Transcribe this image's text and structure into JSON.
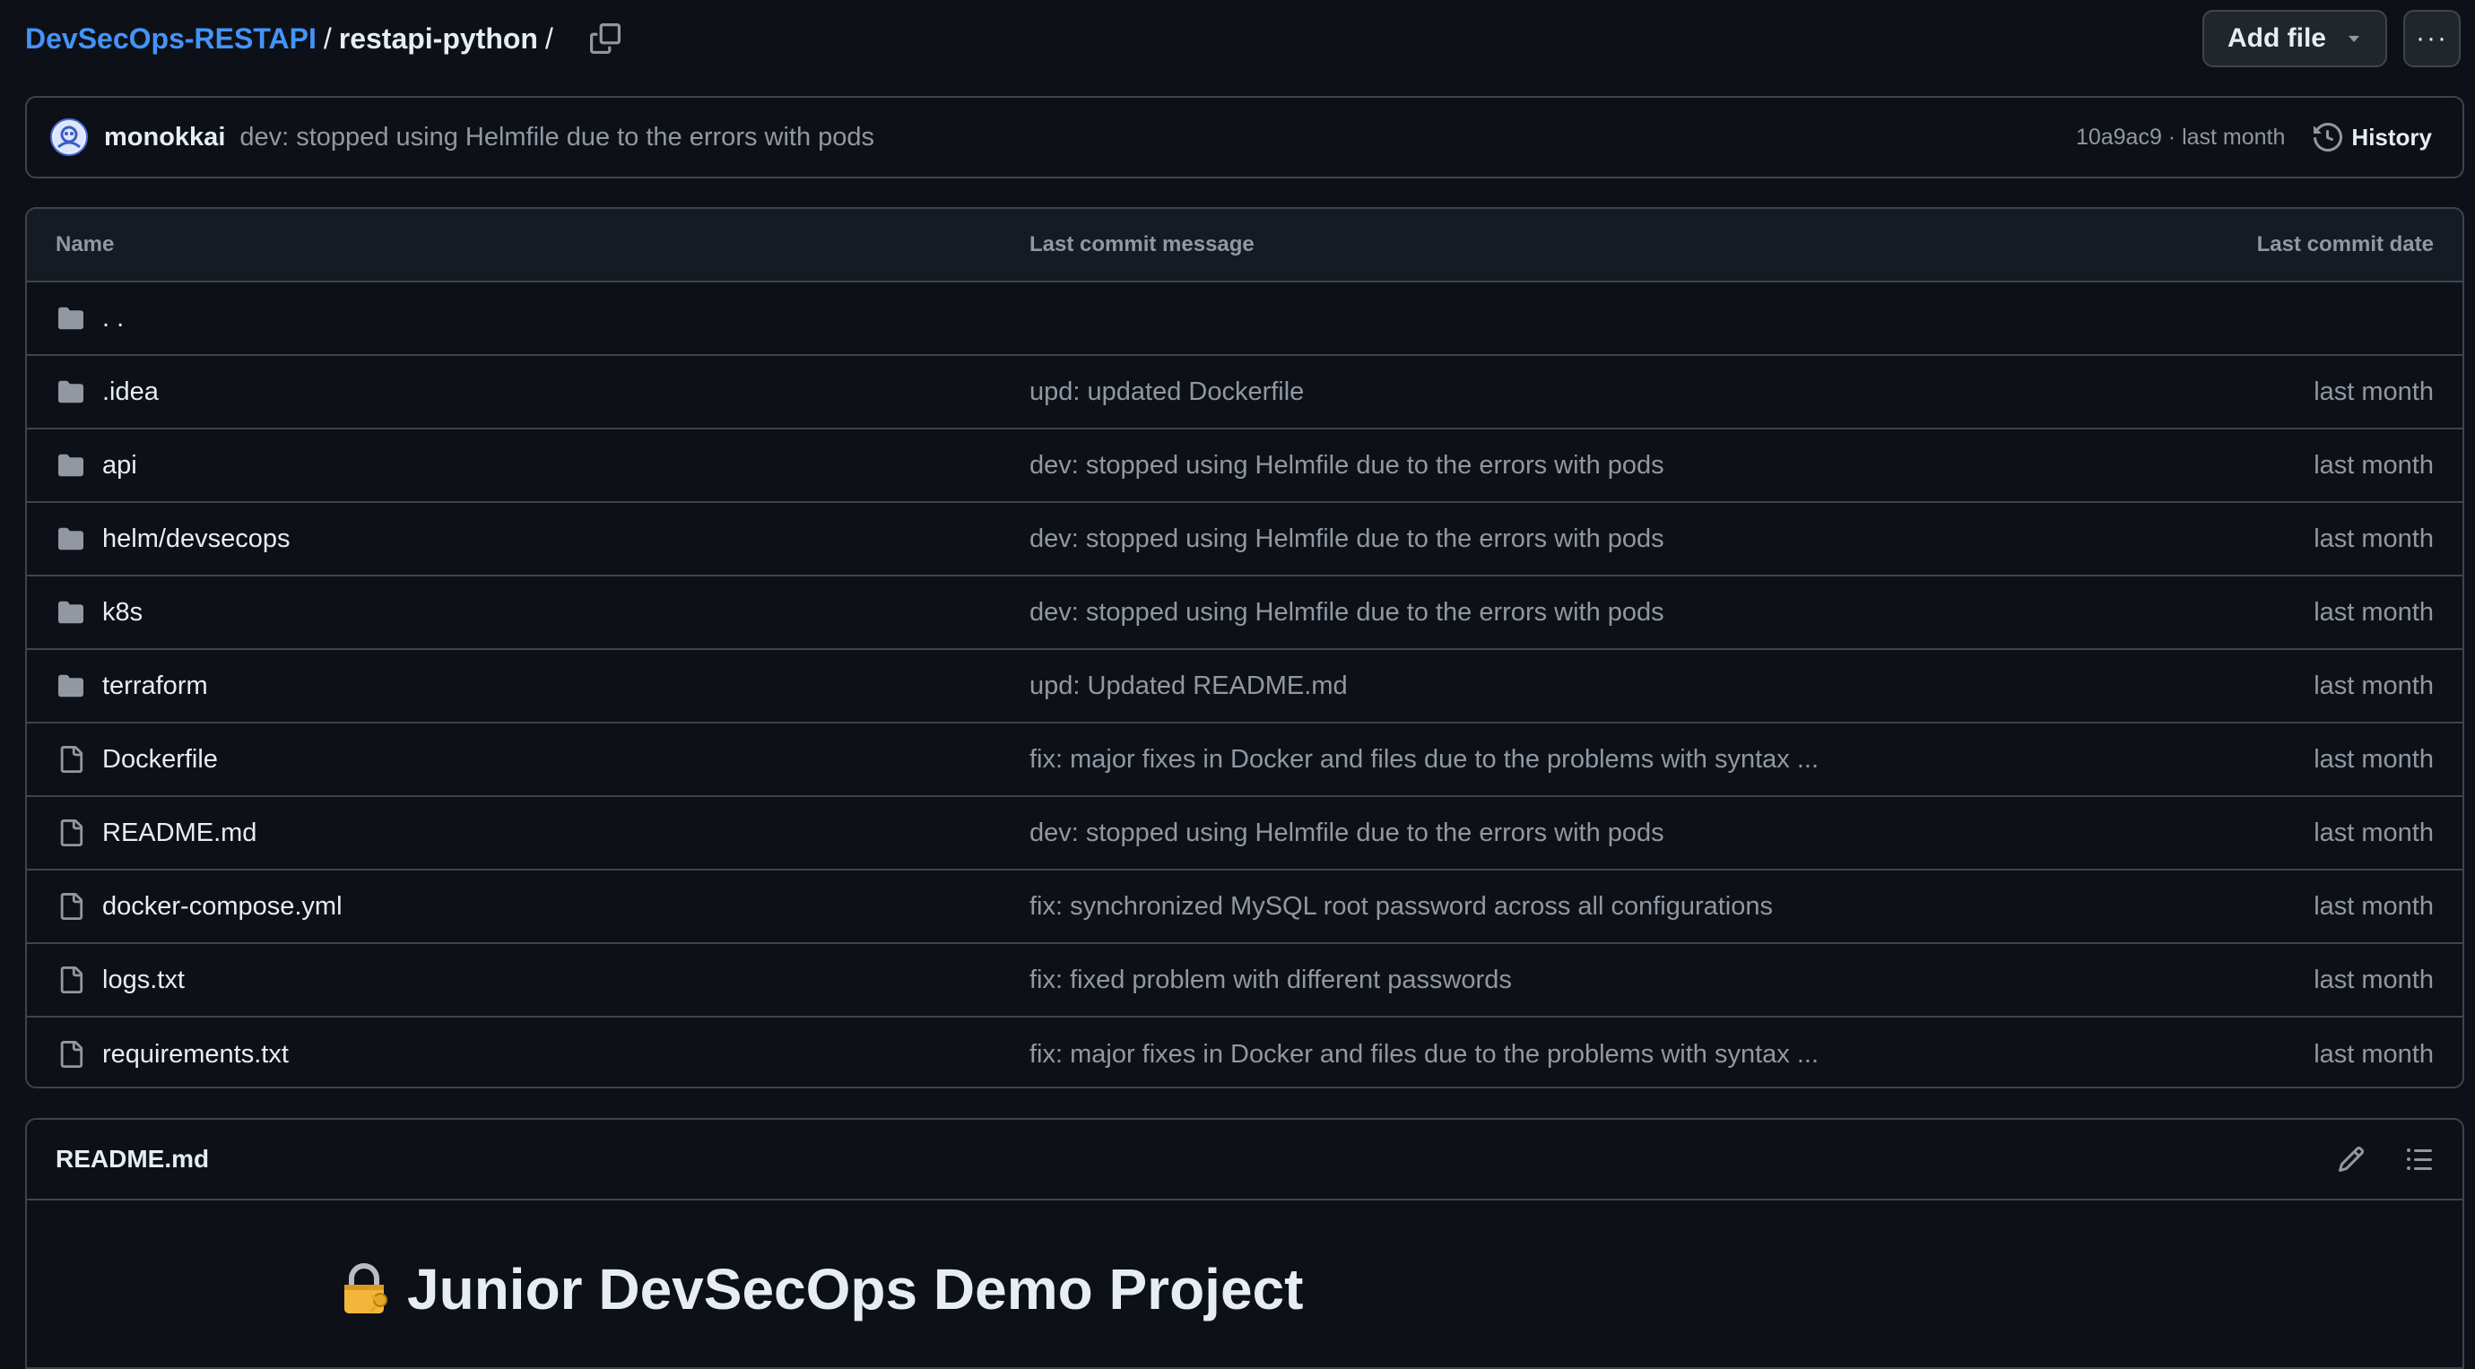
{
  "breadcrumb": {
    "repo": "DevSecOps-RESTAPI",
    "separator": "/",
    "folder": "restapi-python",
    "trailing": "/"
  },
  "toolbar": {
    "add_file_label": "Add file",
    "more_label": "···"
  },
  "commit": {
    "author": "monokkai",
    "message": "dev: stopped using Helmfile due to the errors with pods",
    "meta": "10a9ac9 · last month",
    "history_label": "History"
  },
  "table": {
    "headers": {
      "name": "Name",
      "message": "Last commit message",
      "date": "Last commit date"
    },
    "rows": [
      {
        "type": "parent",
        "name": ". .",
        "message": "",
        "date": ""
      },
      {
        "type": "folder",
        "name": ".idea",
        "message": "upd: updated Dockerfile",
        "date": "last month"
      },
      {
        "type": "folder",
        "name": "api",
        "message": "dev: stopped using Helmfile due to the errors with pods",
        "date": "last month"
      },
      {
        "type": "folder",
        "name": "helm/devsecops",
        "message": "dev: stopped using Helmfile due to the errors with pods",
        "date": "last month"
      },
      {
        "type": "folder",
        "name": "k8s",
        "message": "dev: stopped using Helmfile due to the errors with pods",
        "date": "last month"
      },
      {
        "type": "folder",
        "name": "terraform",
        "message": "upd: Updated README.md",
        "date": "last month"
      },
      {
        "type": "file",
        "name": "Dockerfile",
        "message": "fix: major fixes in Docker and files due to the problems with syntax ...",
        "date": "last month"
      },
      {
        "type": "file",
        "name": "README.md",
        "message": "dev: stopped using Helmfile due to the errors with pods",
        "date": "last month"
      },
      {
        "type": "file",
        "name": "docker-compose.yml",
        "message": "fix: synchronized MySQL root password across all configurations",
        "date": "last month"
      },
      {
        "type": "file",
        "name": "logs.txt",
        "message": "fix: fixed problem with different passwords",
        "date": "last month"
      },
      {
        "type": "file",
        "name": "requirements.txt",
        "message": "fix: major fixes in Docker and files due to the problems with syntax ...",
        "date": "last month"
      }
    ]
  },
  "readme": {
    "title": "README.md",
    "heading": "Junior DevSecOps Demo Project",
    "heading_icon": "lock-with-key-icon"
  },
  "colors": {
    "background": "#0d1117",
    "link": "#4493f8",
    "border": "#3d444d",
    "muted_text": "#9198a1",
    "primary_text": "#e6edf3",
    "header_bg": "#151b23"
  }
}
